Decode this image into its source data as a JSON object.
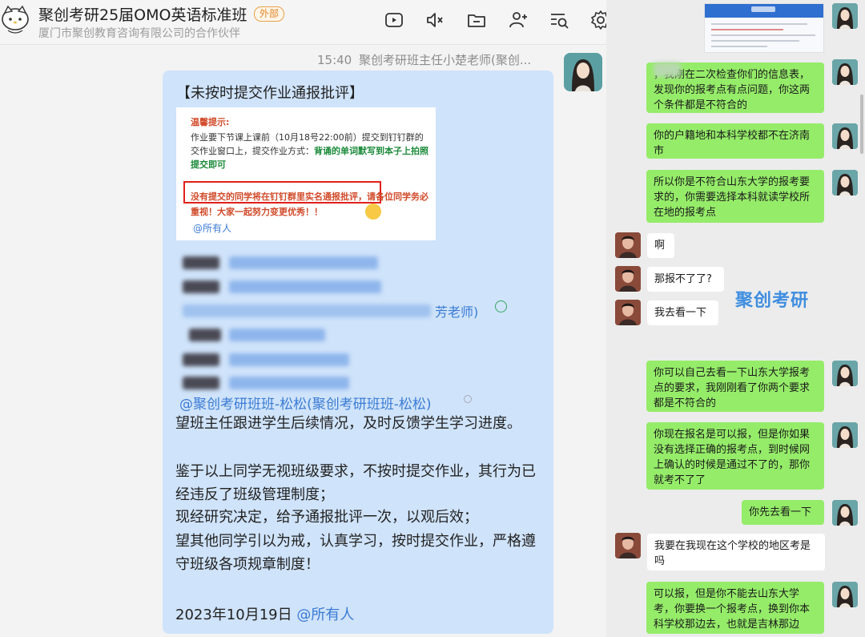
{
  "header": {
    "group_title": "聚创考研25届OMO英语标准班",
    "external_badge": "外部",
    "subtitle": "厦门市聚创教育咨询有限公司的合作伙伴",
    "toolbar_icons": [
      "video-meeting-icon",
      "mute-icon",
      "folder-icon",
      "add-member-icon",
      "search-history-icon",
      "settings-icon"
    ]
  },
  "message": {
    "time": "15:40",
    "sender": "聚创考研班主任小楚老师(聚创...",
    "title": "【未按时提交作业通报批评】",
    "reminder": {
      "heading": "温馨提示:",
      "line1_plain": "作业要下节课上课前（10月18号22:00前）提交到钉钉群的交作业窗口上，提交作业方式：",
      "line1_green": "背诵的单词默写到本子上拍照提交即可",
      "line2": "没有提交的同学将在钉钉群里实名通报批评，请各位同学务必重视！大家一起努力变更优秀！！",
      "at_all": "@所有人"
    },
    "teacher_tail": "芳老师)",
    "mention": "@聚创考研班班-松松(聚创考研班班-松松)",
    "paragraph1": "望班主任跟进学生后续情况，及时反馈学生学习进度。",
    "paragraph2": "鉴于以上同学无视班级要求，不按时提交作业，其行为已经违反了班级管理制度；",
    "paragraph3": "现经研究决定，给予通报批评一次，以观后效；",
    "paragraph4": "望其他同学引以为戒，认真学习，按时提交作业，严格遵守班级各项规章制度！",
    "date": "2023年10月19日",
    "date_mention": "@所有人"
  },
  "chat": {
    "watermark": "聚创考研",
    "messages": [
      {
        "from": "me",
        "text": "，我刚在二次检查你们的信息表，发现你的报考点有点问题，你这两个条件都是不符合的"
      },
      {
        "from": "me",
        "text": "你的户籍地和本科学校都不在济南市"
      },
      {
        "from": "me",
        "text": "所以你是不符合山东大学的报考要求的，你需要选择本科就读学校所在地的报考点"
      },
      {
        "from": "them",
        "text": "啊"
      },
      {
        "from": "them",
        "text": "那报不了了?"
      },
      {
        "from": "them",
        "text": "我去看一下"
      },
      {
        "from": "me",
        "text": "你可以自己去看一下山东大学报考点的要求，我刚刚看了你两个要求都是不符合的"
      },
      {
        "from": "me",
        "text": "你现在报名是可以报，但是你如果没有选择正确的报考点，到时候网上确认的时候是通过不了的，那你就考不了了"
      },
      {
        "from": "me",
        "text": "你先去看一下"
      },
      {
        "from": "them",
        "text": "我要在我现在这个学校的地区考是吗"
      },
      {
        "from": "me",
        "text": "可以报，但是你不能去山东大学考，你要换一个报考点，换到你本科学校那边去，也就是吉林那边"
      }
    ]
  },
  "colors": {
    "bubble_blue": "#cfe3fa",
    "mention_blue": "#3a7bd5",
    "wechat_green": "#95ec69",
    "badge_orange": "#e2872a",
    "alert_red": "#e0201b"
  }
}
